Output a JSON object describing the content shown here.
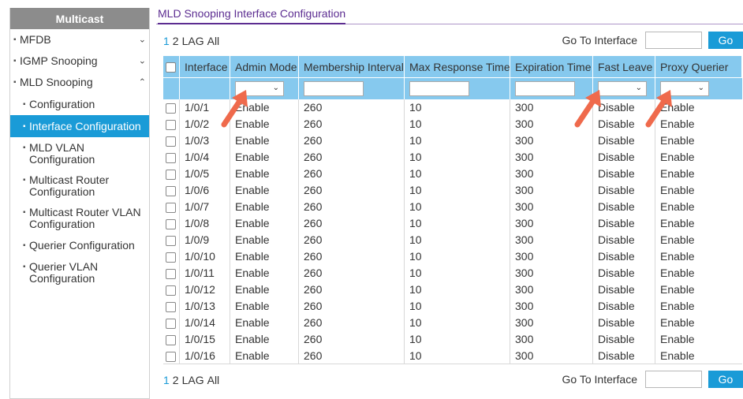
{
  "sidebar": {
    "header": "Multicast",
    "items": [
      {
        "label": "MFDB",
        "chevron": "⌄"
      },
      {
        "label": "IGMP Snooping",
        "chevron": "⌄"
      },
      {
        "label": "MLD Snooping",
        "chevron": "⌃"
      },
      {
        "label": "Configuration"
      },
      {
        "label": "Interface Configuration"
      },
      {
        "label": "MLD VLAN Configuration"
      },
      {
        "label": "Multicast Router Configuration"
      },
      {
        "label": "Multicast Router VLAN Configuration"
      },
      {
        "label": "Querier Configuration"
      },
      {
        "label": "Querier VLAN Configuration"
      }
    ]
  },
  "main": {
    "title": "MLD Snooping Interface Configuration",
    "pager": [
      "1",
      "2",
      "LAG",
      "All"
    ],
    "goto_label": "Go To Interface",
    "go_button": "Go"
  },
  "table": {
    "headers": [
      "Interface",
      "Admin Mode",
      "Membership Interval",
      "Max Response Time",
      "Expiration Time",
      "Fast Leave",
      "Proxy Querier"
    ],
    "rows": [
      [
        "1/0/1",
        "Enable",
        "260",
        "10",
        "300",
        "Disable",
        "Enable"
      ],
      [
        "1/0/2",
        "Enable",
        "260",
        "10",
        "300",
        "Disable",
        "Enable"
      ],
      [
        "1/0/3",
        "Enable",
        "260",
        "10",
        "300",
        "Disable",
        "Enable"
      ],
      [
        "1/0/4",
        "Enable",
        "260",
        "10",
        "300",
        "Disable",
        "Enable"
      ],
      [
        "1/0/5",
        "Enable",
        "260",
        "10",
        "300",
        "Disable",
        "Enable"
      ],
      [
        "1/0/6",
        "Enable",
        "260",
        "10",
        "300",
        "Disable",
        "Enable"
      ],
      [
        "1/0/7",
        "Enable",
        "260",
        "10",
        "300",
        "Disable",
        "Enable"
      ],
      [
        "1/0/8",
        "Enable",
        "260",
        "10",
        "300",
        "Disable",
        "Enable"
      ],
      [
        "1/0/9",
        "Enable",
        "260",
        "10",
        "300",
        "Disable",
        "Enable"
      ],
      [
        "1/0/10",
        "Enable",
        "260",
        "10",
        "300",
        "Disable",
        "Enable"
      ],
      [
        "1/0/11",
        "Enable",
        "260",
        "10",
        "300",
        "Disable",
        "Enable"
      ],
      [
        "1/0/12",
        "Enable",
        "260",
        "10",
        "300",
        "Disable",
        "Enable"
      ],
      [
        "1/0/13",
        "Enable",
        "260",
        "10",
        "300",
        "Disable",
        "Enable"
      ],
      [
        "1/0/14",
        "Enable",
        "260",
        "10",
        "300",
        "Disable",
        "Enable"
      ],
      [
        "1/0/15",
        "Enable",
        "260",
        "10",
        "300",
        "Disable",
        "Enable"
      ],
      [
        "1/0/16",
        "Enable",
        "260",
        "10",
        "300",
        "Disable",
        "Enable"
      ]
    ]
  },
  "colors": {
    "accent": "#1a9bd7",
    "header_bg": "#86c9ee",
    "title": "#5c2d91",
    "annotation_arrow": "#ef6a4c"
  }
}
